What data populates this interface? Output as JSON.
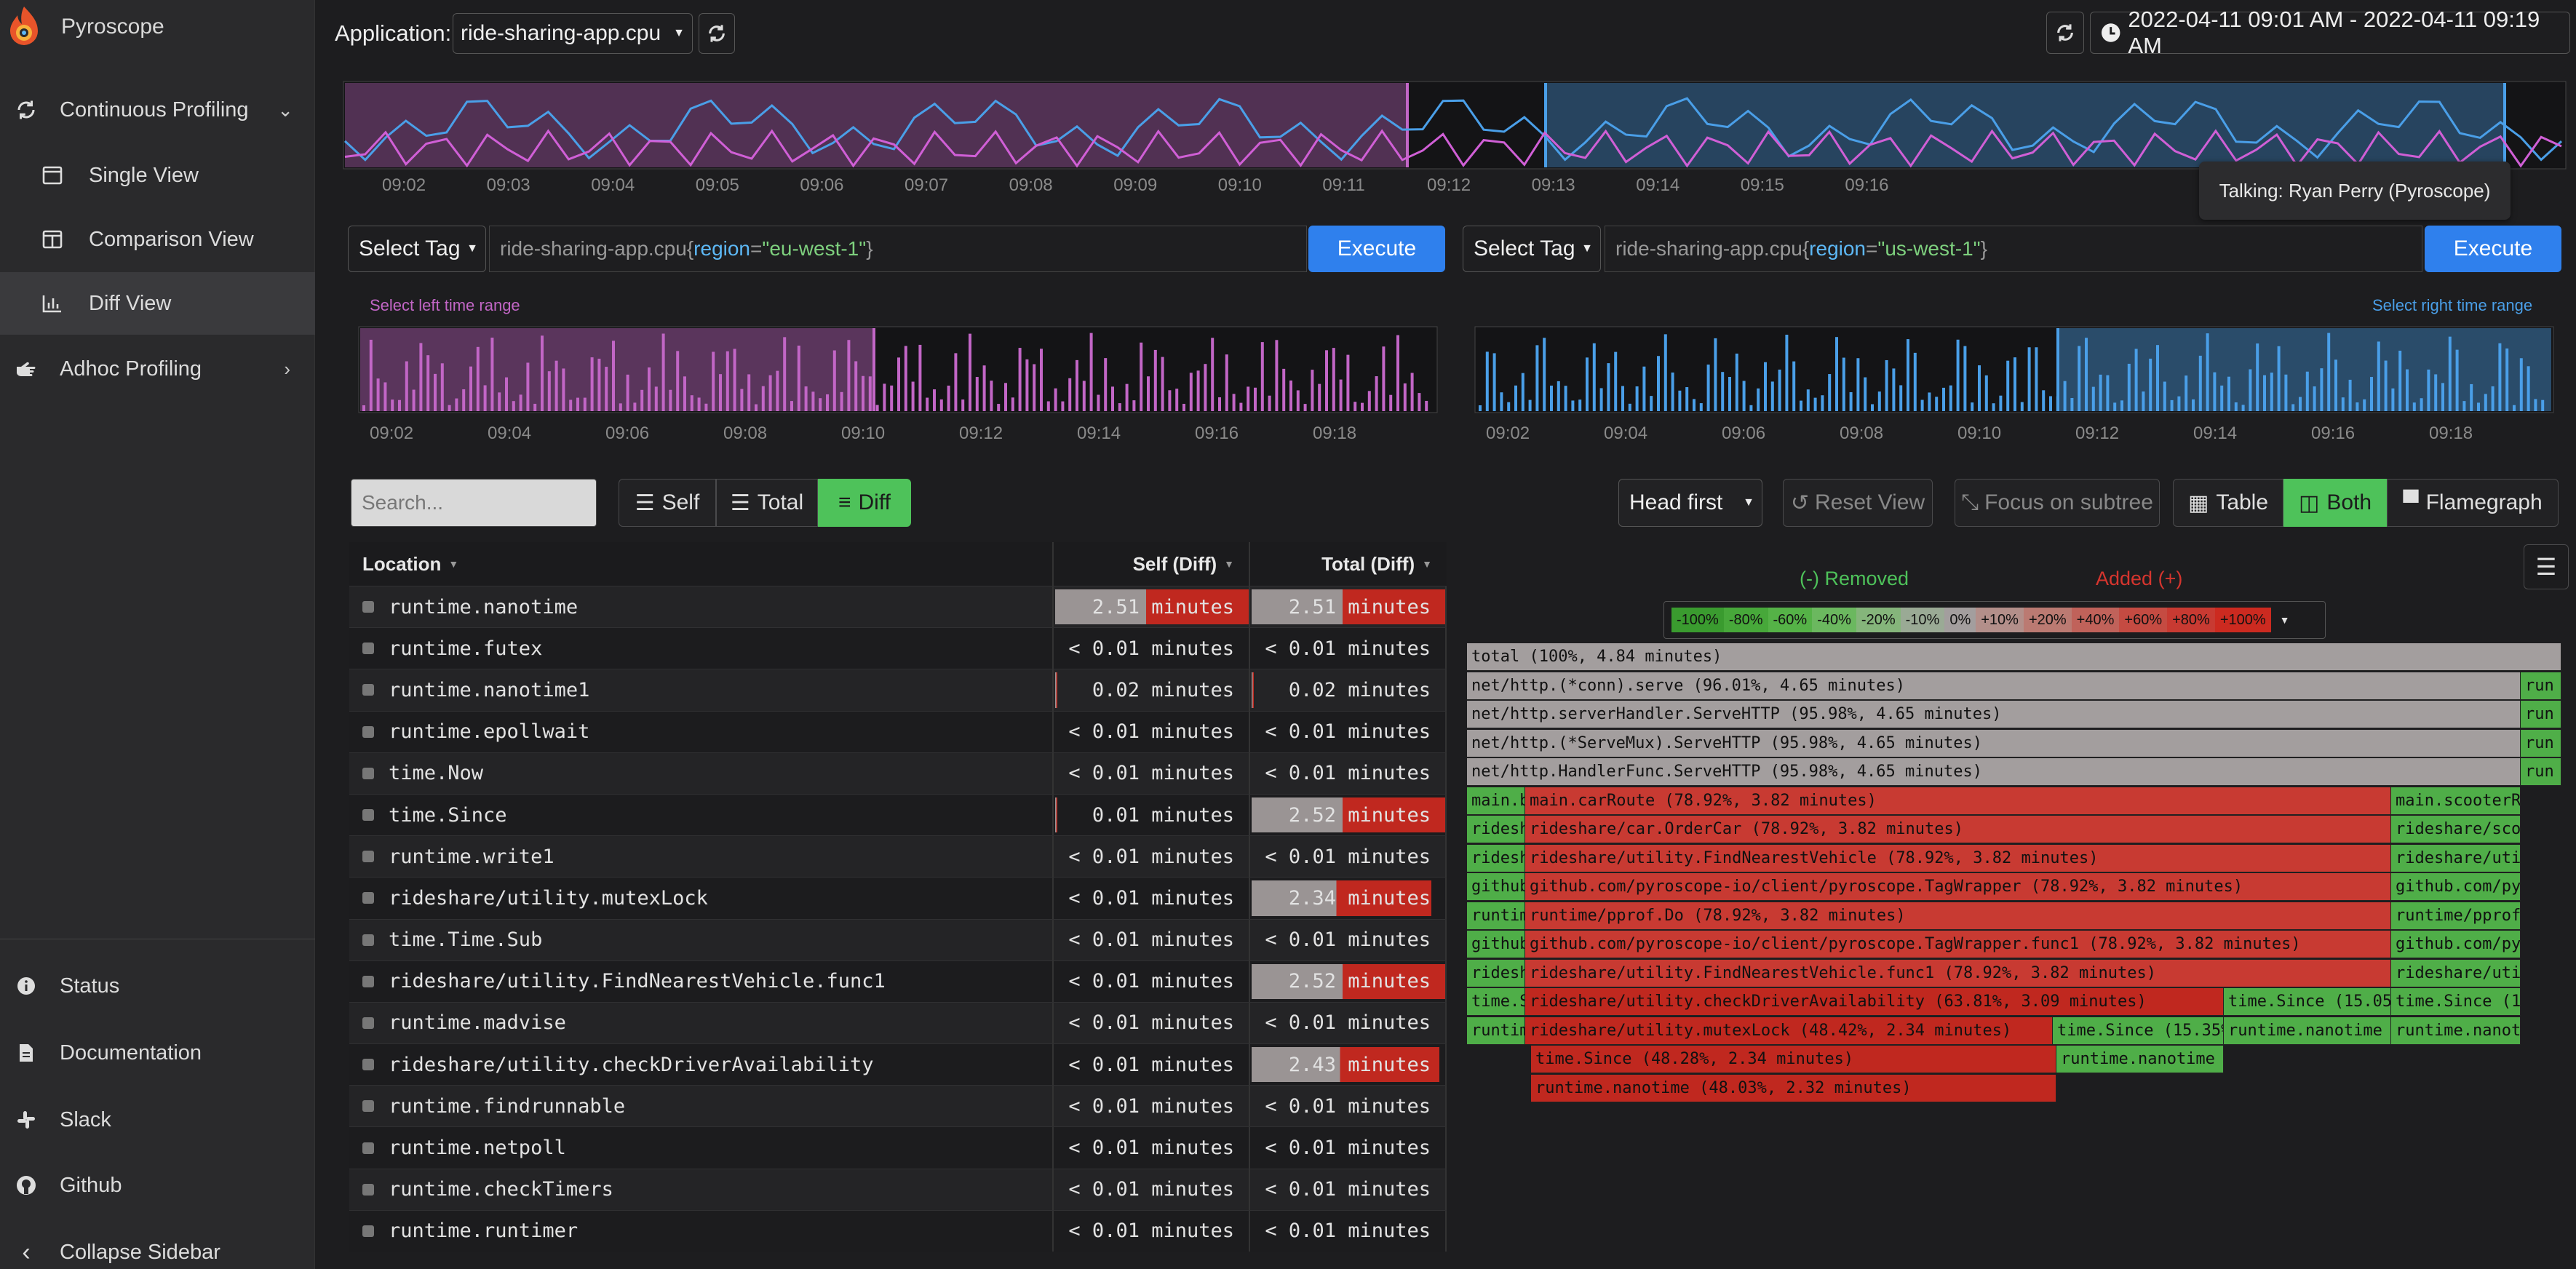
{
  "sidebar": {
    "brand": "Pyroscope",
    "items": [
      {
        "label": "Continuous Profiling"
      },
      {
        "label": "Single View"
      },
      {
        "label": "Comparison View"
      },
      {
        "label": "Diff View"
      },
      {
        "label": "Adhoc Profiling"
      }
    ],
    "bottom": [
      {
        "label": "Status"
      },
      {
        "label": "Documentation"
      },
      {
        "label": "Slack"
      },
      {
        "label": "Github"
      },
      {
        "label": "Collapse Sidebar"
      }
    ]
  },
  "toolbar": {
    "app_label": "Application:",
    "app_value": "ride-sharing-app.cpu",
    "time_range": "2022-04-11 09:01 AM - 2022-04-11 09:19 AM"
  },
  "tooltip": "Talking: Ryan Perry (Pyroscope)",
  "main_timeline": {
    "ticks": [
      "09:02",
      "09:03",
      "09:04",
      "09:05",
      "09:06",
      "09:07",
      "09:08",
      "09:09",
      "09:10",
      "09:11",
      "09:12",
      "09:13",
      "09:14",
      "09:15",
      "09:16"
    ]
  },
  "left": {
    "select_tag": "Select Tag",
    "query_app": "ride-sharing-app.cpu{",
    "query_key": "region",
    "query_eq": "=",
    "query_val": "\"eu-west-1\"",
    "query_end": "}",
    "execute": "Execute",
    "range_label": "Select left time range",
    "ticks": [
      "09:02",
      "09:04",
      "09:06",
      "09:08",
      "09:10",
      "09:12",
      "09:14",
      "09:16",
      "09:18"
    ]
  },
  "right": {
    "select_tag": "Select Tag",
    "query_app": "ride-sharing-app.cpu{",
    "query_key": "region",
    "query_eq": "=",
    "query_val": "\"us-west-1\"",
    "query_end": "}",
    "execute": "Execute",
    "range_label": "Select right time range",
    "ticks": [
      "09:02",
      "09:04",
      "09:06",
      "09:08",
      "09:10",
      "09:12",
      "09:14",
      "09:16",
      "09:18"
    ]
  },
  "controls": {
    "search_placeholder": "Search...",
    "self": "Self",
    "total": "Total",
    "diff": "Diff",
    "head_first": "Head first",
    "reset_view": "Reset View",
    "focus_subtree": "Focus on subtree",
    "table": "Table",
    "both": "Both",
    "flamegraph": "Flamegraph"
  },
  "table": {
    "headers": {
      "location": "Location",
      "self": "Self (Diff)",
      "total": "Total (Diff)"
    },
    "rows": [
      {
        "loc": "runtime.nanotime",
        "self": "2.51 minutes",
        "total": "2.51 minutes",
        "self_bar": 1.0,
        "total_bar": 1.0
      },
      {
        "loc": "runtime.futex",
        "self": "< 0.01 minutes",
        "total": "< 0.01 minutes",
        "self_bar": 0,
        "total_bar": 0
      },
      {
        "loc": "runtime.nanotime1",
        "self": "0.02 minutes",
        "total": "0.02 minutes",
        "self_bar": 0.01,
        "total_bar": 0.01
      },
      {
        "loc": "runtime.epollwait",
        "self": "< 0.01 minutes",
        "total": "< 0.01 minutes",
        "self_bar": 0,
        "total_bar": 0
      },
      {
        "loc": "time.Now",
        "self": "< 0.01 minutes",
        "total": "< 0.01 minutes",
        "self_bar": 0,
        "total_bar": 0
      },
      {
        "loc": "time.Since",
        "self": "0.01 minutes",
        "total": "2.52 minutes",
        "self_bar": 0.01,
        "total_bar": 1.0
      },
      {
        "loc": "runtime.write1",
        "self": "< 0.01 minutes",
        "total": "< 0.01 minutes",
        "self_bar": 0,
        "total_bar": 0
      },
      {
        "loc": "rideshare/utility.mutexLock",
        "self": "< 0.01 minutes",
        "total": "2.34 minutes",
        "self_bar": 0,
        "total_bar": 0.93
      },
      {
        "loc": "time.Time.Sub",
        "self": "< 0.01 minutes",
        "total": "< 0.01 minutes",
        "self_bar": 0,
        "total_bar": 0
      },
      {
        "loc": "rideshare/utility.FindNearestVehicle.func1",
        "self": "< 0.01 minutes",
        "total": "2.52 minutes",
        "self_bar": 0,
        "total_bar": 1.0
      },
      {
        "loc": "runtime.madvise",
        "self": "< 0.01 minutes",
        "total": "< 0.01 minutes",
        "self_bar": 0,
        "total_bar": 0
      },
      {
        "loc": "rideshare/utility.checkDriverAvailability",
        "self": "< 0.01 minutes",
        "total": "2.43 minutes",
        "self_bar": 0,
        "total_bar": 0.97
      },
      {
        "loc": "runtime.findrunnable",
        "self": "< 0.01 minutes",
        "total": "< 0.01 minutes",
        "self_bar": 0,
        "total_bar": 0
      },
      {
        "loc": "runtime.netpoll",
        "self": "< 0.01 minutes",
        "total": "< 0.01 minutes",
        "self_bar": 0,
        "total_bar": 0
      },
      {
        "loc": "runtime.checkTimers",
        "self": "< 0.01 minutes",
        "total": "< 0.01 minutes",
        "self_bar": 0,
        "total_bar": 0
      },
      {
        "loc": "runtime.runtimer",
        "self": "< 0.01 minutes",
        "total": "< 0.01 minutes",
        "self_bar": 0,
        "total_bar": 0
      }
    ]
  },
  "legend": {
    "removed": "(-) Removed",
    "added": "Added (+)",
    "scale": [
      "-100%",
      "-80%",
      "-60%",
      "-40%",
      "-20%",
      "-10%",
      "0%",
      "+10%",
      "+20%",
      "+40%",
      "+60%",
      "+80%",
      "+100%"
    ]
  },
  "flamegraph": {
    "rows": [
      [
        {
          "t": "total (100%, 4.84 minutes)",
          "c": "grey"
        }
      ],
      [
        {
          "t": "net/http.(*conn).serve (96.01%, 4.65 minutes)",
          "c": "grey"
        },
        {
          "t": "run",
          "c": "green"
        }
      ],
      [
        {
          "t": "net/http.serverHandler.ServeHTTP (95.98%, 4.65 minutes)",
          "c": "grey"
        },
        {
          "t": "run",
          "c": "green"
        }
      ],
      [
        {
          "t": "net/http.(*ServeMux).ServeHTTP (95.98%, 4.65 minutes)",
          "c": "grey"
        },
        {
          "t": "run",
          "c": "green"
        }
      ],
      [
        {
          "t": "net/http.HandlerFunc.ServeHTTP (95.98%, 4.65 minutes)",
          "c": "grey"
        },
        {
          "t": "run",
          "c": "green"
        }
      ],
      [
        {
          "t": "main.b",
          "c": "green"
        },
        {
          "t": "main.carRoute (78.92%, 3.82 minutes)",
          "c": "red"
        },
        {
          "t": "main.scooterRo",
          "c": "green"
        }
      ],
      [
        {
          "t": "ridesh",
          "c": "green"
        },
        {
          "t": "rideshare/car.OrderCar (78.92%, 3.82 minutes)",
          "c": "red"
        },
        {
          "t": "rideshare/scoo",
          "c": "green"
        }
      ],
      [
        {
          "t": "ridesh",
          "c": "green"
        },
        {
          "t": "rideshare/utility.FindNearestVehicle (78.92%, 3.82 minutes)",
          "c": "red"
        },
        {
          "t": "rideshare/util",
          "c": "green"
        }
      ],
      [
        {
          "t": "github",
          "c": "green"
        },
        {
          "t": "github.com/pyroscope-io/client/pyroscope.TagWrapper (78.92%, 3.82 minutes)",
          "c": "red"
        },
        {
          "t": "github.com/pyr",
          "c": "green"
        }
      ],
      [
        {
          "t": "runtim",
          "c": "green"
        },
        {
          "t": "runtime/pprof.Do (78.92%, 3.82 minutes)",
          "c": "red"
        },
        {
          "t": "runtime/pprof.",
          "c": "green"
        }
      ],
      [
        {
          "t": "github",
          "c": "green"
        },
        {
          "t": "github.com/pyroscope-io/client/pyroscope.TagWrapper.func1 (78.92%, 3.82 minutes)",
          "c": "red"
        },
        {
          "t": "github.com/pyr",
          "c": "green"
        }
      ],
      [
        {
          "t": "ridesh",
          "c": "green"
        },
        {
          "t": "rideshare/utility.FindNearestVehicle.func1 (78.92%, 3.82 minutes)",
          "c": "red"
        },
        {
          "t": "rideshare/util",
          "c": "green"
        }
      ],
      [
        {
          "t": "time.S",
          "c": "green"
        },
        {
          "t": "rideshare/utility.checkDriverAvailability (63.81%, 3.09 minutes)",
          "c": "dred"
        },
        {
          "t": "time.Since (15.05%",
          "c": "green"
        },
        {
          "t": "time.Since (11",
          "c": "green"
        }
      ],
      [
        {
          "t": "runtim",
          "c": "green"
        },
        {
          "t": "rideshare/utility.mutexLock (48.42%, 2.34 minutes)",
          "c": "dred"
        },
        {
          "t": "time.Since (15.35%",
          "c": "green"
        },
        {
          "t": "runtime.nanotime (",
          "c": "green"
        },
        {
          "t": "runtime.nanoti",
          "c": "green"
        }
      ],
      [
        {
          "t": "time.Since (48.28%, 2.34 minutes)",
          "c": "dred"
        },
        {
          "t": "runtime.nanotime (",
          "c": "green"
        }
      ],
      [
        {
          "t": "runtime.nanotime (48.03%, 2.32 minutes)",
          "c": "dred"
        }
      ]
    ]
  },
  "colors": {
    "accent_blue": "#2f80ed",
    "diff_green": "#4ec25a",
    "left_pink": "#c266c6",
    "right_blue": "#4a9fe8",
    "added_red": "#c83a32"
  }
}
